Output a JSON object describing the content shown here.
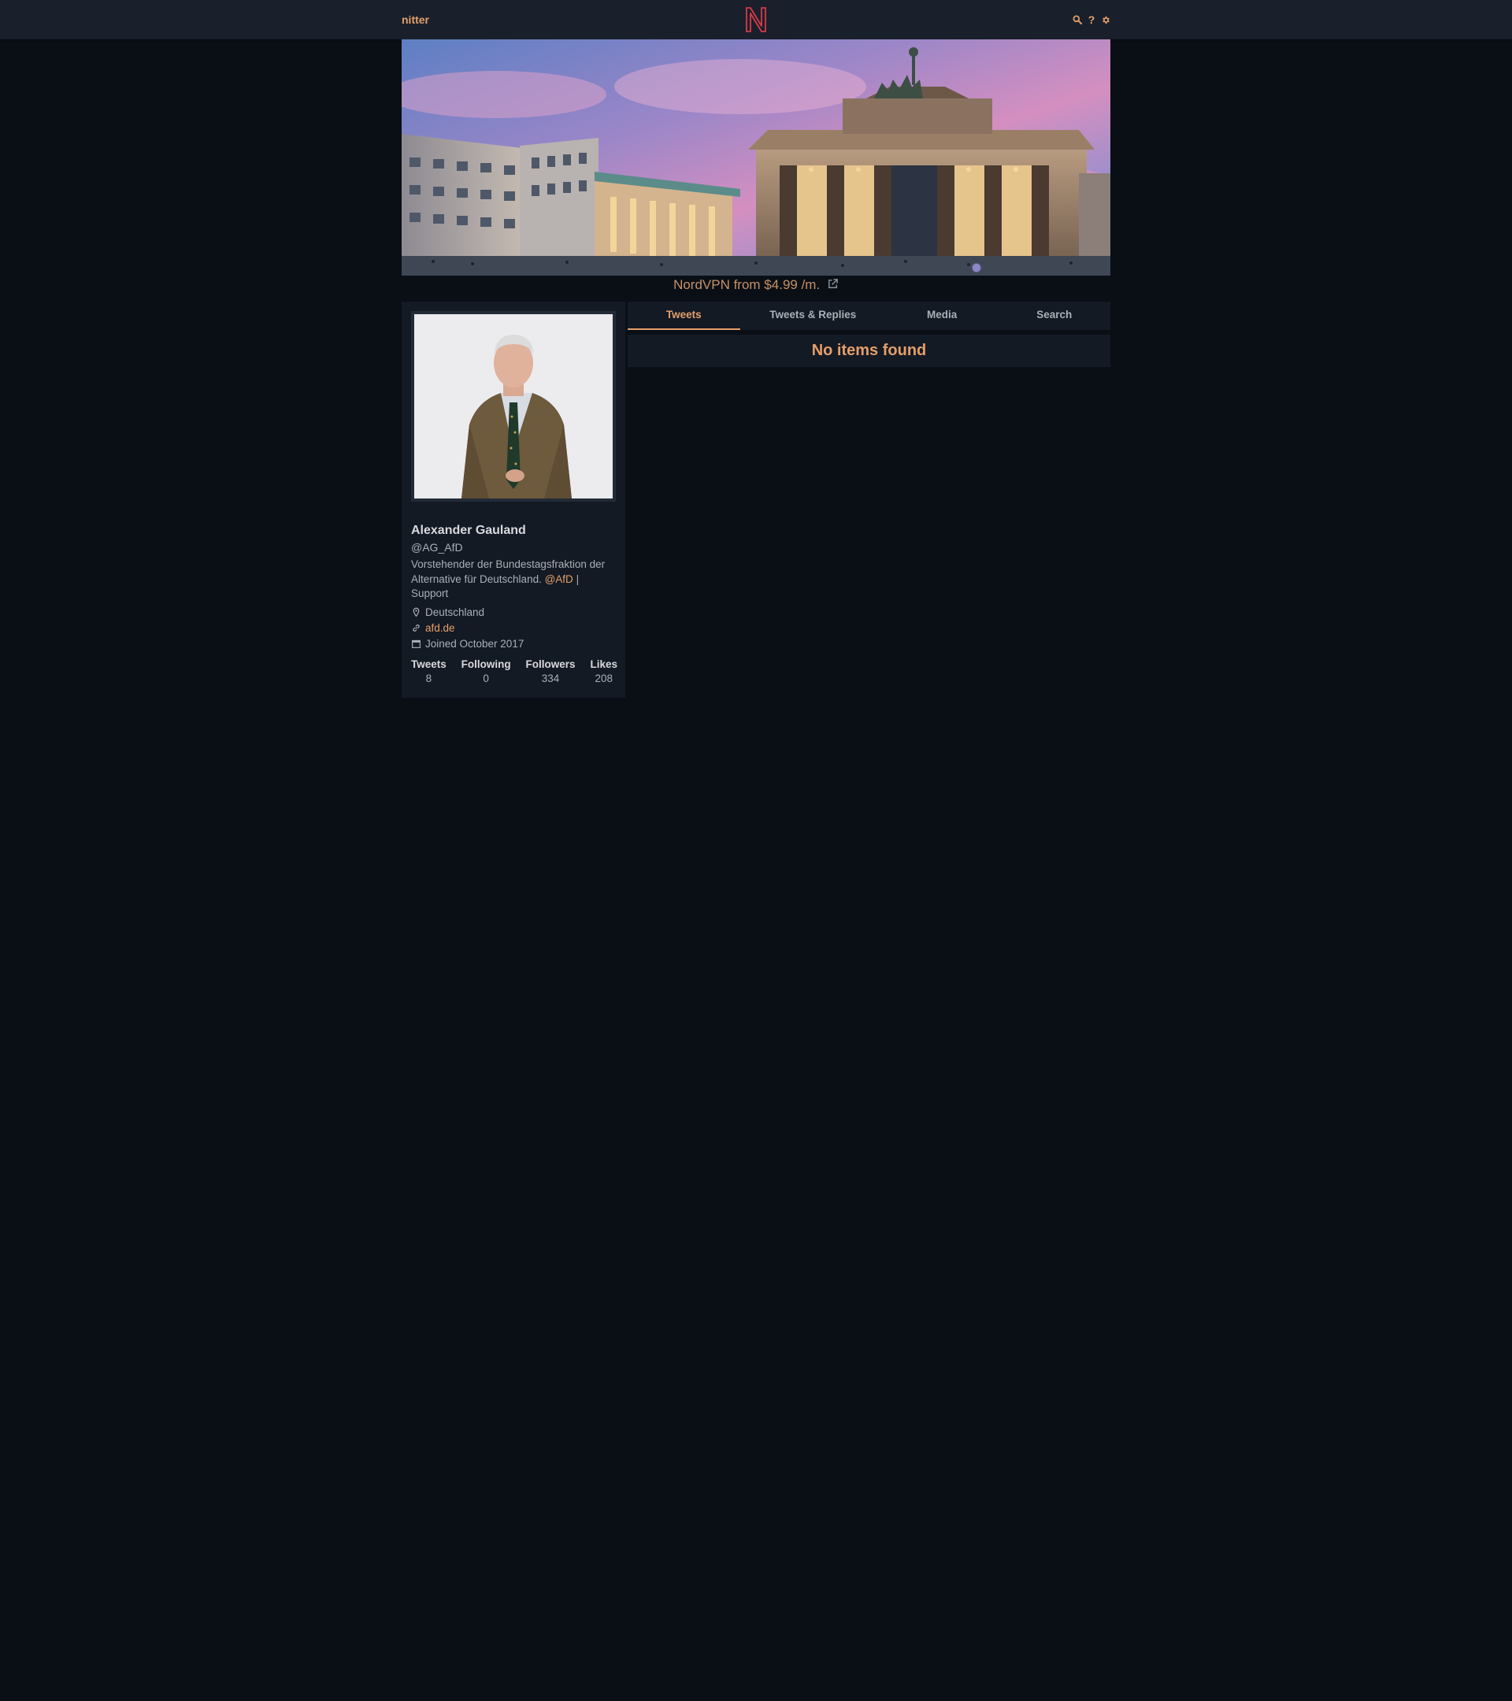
{
  "navbar": {
    "brand": "nitter",
    "logo_icon": "nitter-n-logo",
    "icons": [
      "search-icon",
      "help-icon",
      "settings-icon"
    ],
    "help_glyph": "?"
  },
  "banner": {
    "image": "banner-brandenburg-gate"
  },
  "ad": {
    "text": "NordVPN from $4.99 /m.",
    "icon": "external-link-icon"
  },
  "profile": {
    "avatar": "avatar-photo",
    "fullname": "Alexander Gauland",
    "username": "@AG_AfD",
    "bio_before": "Vorstehender der Bundestagsfraktion der Alternative für Deutschland. ",
    "bio_mention": "@AfD",
    "bio_after": " | Support",
    "location": "Deutschland",
    "website": "afd.de",
    "joined": "Joined October 2017",
    "stats": {
      "tweets_label": "Tweets",
      "tweets": "8",
      "following_label": "Following",
      "following": "0",
      "followers_label": "Followers",
      "followers": "334",
      "likes_label": "Likes",
      "likes": "208"
    }
  },
  "tabs": {
    "tweets": "Tweets",
    "replies": "Tweets & Replies",
    "media": "Media",
    "search": "Search",
    "active": "Tweets"
  },
  "timeline": {
    "empty_message": "No items found"
  },
  "colors": {
    "accent": "#e49f69",
    "logo": "#d93a48",
    "background": "#0a0f16",
    "panel": "#141a24",
    "navbar": "#19202c"
  }
}
